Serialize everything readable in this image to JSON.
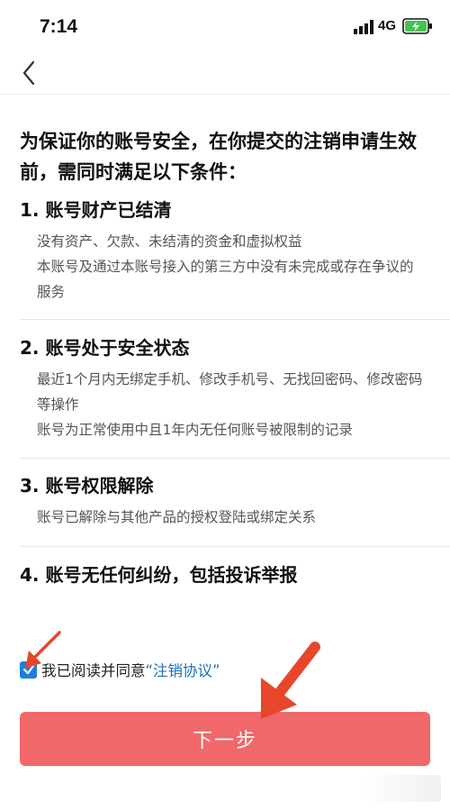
{
  "status_bar": {
    "time": "7:14",
    "network": "4G",
    "battery_color": "#43c451"
  },
  "nav": {
    "back_icon": "chevron-left-icon"
  },
  "content": {
    "intro": "为保证你的账号安全，在你提交的注销申请生效前，需同时满足以下条件：",
    "sections": [
      {
        "title": "1. 账号财产已结清",
        "lines": [
          "没有资产、欠款、未结清的资金和虚拟权益",
          "本账号及通过本账号接入的第三方中没有未完成或存在争议的服务"
        ]
      },
      {
        "title": "2. 账号处于安全状态",
        "lines": [
          "最近1个月内无绑定手机、修改手机号、无找回密码、修改密码等操作",
          "账号为正常使用中且1年内无任何账号被限制的记录"
        ]
      },
      {
        "title": "3. 账号权限解除",
        "lines": [
          "账号已解除与其他产品的授权登陆或绑定关系"
        ]
      },
      {
        "title": "4. 账号无任何纠纷，包括投诉举报",
        "lines": []
      }
    ]
  },
  "agreement": {
    "checked": true,
    "text": "我已阅读并同意",
    "link_text": "“注销协议”"
  },
  "next_button": {
    "label": "下一步",
    "color": "#f0686a"
  },
  "colors": {
    "accent": "#1e7fd6",
    "annotation_arrow": "#e8462a"
  }
}
